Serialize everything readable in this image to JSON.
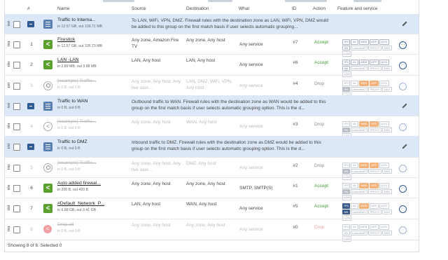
{
  "headers": {
    "num": "#",
    "name": "Name",
    "source": "Source",
    "destination": "Destination",
    "what": "What",
    "id": "ID",
    "action": "Action",
    "feature": "Feature and service"
  },
  "rows": [
    {
      "kind": "group",
      "name": "Traffic to Interna...",
      "sub": "in 12.57 GB, out 109.71 MB",
      "desc": "To LAN, WiFi, VPN, DMZ. Firewall rules with the destination zone as LAN, WiFi, VPN, DMZ would be added to this group on the first match basis if user selects automatic grouping..."
    },
    {
      "kind": "rule",
      "num": "1",
      "icon": "allow",
      "name": "Firestick",
      "sub": "in 12.57 GB, out 105.73 MB",
      "source": "Any zone, Amazon Fire TV",
      "destination": "Any zone, Any host",
      "what": "Any service",
      "id": "#7",
      "action": "Accept",
      "tags": "on"
    },
    {
      "kind": "rule",
      "num": "2",
      "icon": "allow",
      "name": "LAN -LAN",
      "sub": "in 2.89 MB, out 3.98 MB",
      "source": "LAN, Any host",
      "destination": "LAN, Any host",
      "what": "Any service",
      "id": "#6",
      "action": "Accept",
      "tags": "on"
    },
    {
      "kind": "rule",
      "off": true,
      "num": "3",
      "icon": "user",
      "name": "[example] Traffic...",
      "sub": "in 0 B, out 0 B",
      "source": "Any zone, Any host, Any live user...",
      "destination": "LAN, DMZ, WiFi, VPN, Any host",
      "what": "Any service",
      "id": "#4",
      "action": "Drop",
      "tags": "orange"
    },
    {
      "kind": "group",
      "name": "Traffic to WAN",
      "sub": "in 0 B, out 0 B",
      "desc": "Outbound traffic to WAN. Firewall rules with the destination zone as WAN would be added to this group on the first match basis if user selects automatic grouping option. This is the d..."
    },
    {
      "kind": "rule",
      "off": true,
      "num": "4",
      "icon": "dropi",
      "name": "[example] Traffic...",
      "sub": "in 0 B, out 0 B",
      "source": "Any zone, Any host",
      "destination": "WAN, Any host",
      "what": "Any service",
      "id": "#3",
      "action": "Drop",
      "tags": "orange"
    },
    {
      "kind": "group",
      "name": "Traffic to DMZ",
      "sub": "in 0 B, out 0 B",
      "desc": "Inbound traffic to DMZ. Firewall rules with the destination zone as DMZ would be added to this group on the first match basis if user selects automatic grouping option. This is the d..."
    },
    {
      "kind": "rule",
      "off": true,
      "num": "5",
      "icon": "user",
      "name": "[example] Traffic...",
      "sub": "in 0 B, out 0 B",
      "source": "Any zone, Any host, Any live user...",
      "destination": "DMZ, Any host",
      "what": "Any service",
      "id": "#2",
      "action": "Drop",
      "tags": "orange"
    },
    {
      "kind": "rule",
      "num": "6",
      "icon": "allow",
      "name": "Auto added firewal...",
      "sub": "in 200 B, out 420 B",
      "source": "Any zone, Any host",
      "destination": "Any zone, Any host",
      "what": "SMTP, SMTP(S)",
      "id": "#1",
      "action": "Accept",
      "tags": "orange"
    },
    {
      "kind": "rule",
      "num": "7",
      "icon": "allow",
      "name": "#Default_Network_P...",
      "sub": "in 6.88 GB, out 3.41 GB",
      "source": "LAN, Any host",
      "destination": "WAN, Any host",
      "what": "Any service",
      "id": "#5",
      "action": "Accept",
      "tags": "navy"
    },
    {
      "kind": "rule",
      "off": true,
      "num": "8",
      "icon": "dropred",
      "name": "Drop all",
      "sub": "in 0 B, out 0 B",
      "source": "Any zone, Any host",
      "destination": "Any zone, Any host",
      "what": "Any service",
      "id": "#0",
      "action": "Drop",
      "tags": "faint"
    }
  ],
  "tag_labels": [
    "IPS",
    "AV",
    "WEB",
    "APP",
    "QOS",
    "HB",
    "LinkedNAT",
    "PROXY",
    "DNS",
    "LOG"
  ],
  "footer": "Showing 8 of 8. Selected 0"
}
